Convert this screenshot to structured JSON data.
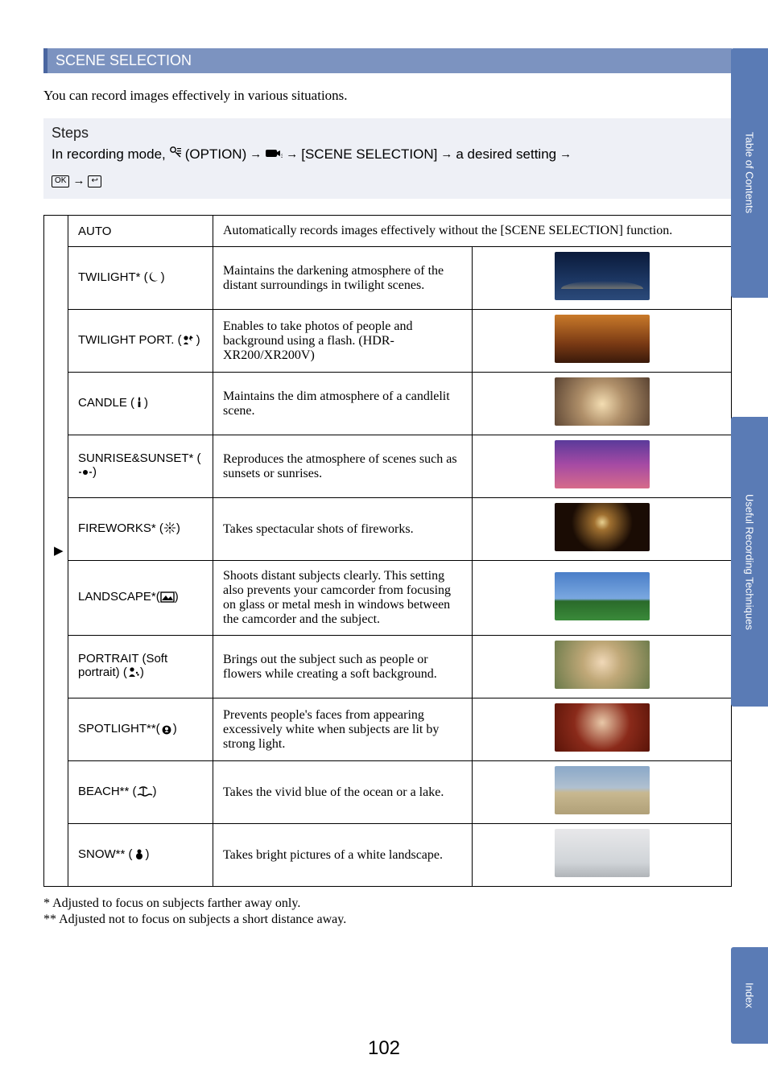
{
  "sidebar": {
    "tabs": [
      {
        "label": "Table of Contents"
      },
      {
        "label": "Useful Recording Techniques"
      },
      {
        "label": "Index"
      }
    ]
  },
  "section_heading": "SCENE SELECTION",
  "intro": "You can record images effectively in various situations.",
  "steps": {
    "title": "Steps",
    "prefix": "In recording mode, ",
    "option_label": " (OPTION) ",
    "bracket": "[SCENE SELECTION]",
    "suffix": " a desired setting ",
    "ok": "OK",
    "ret": "↩"
  },
  "scenes": [
    {
      "mark": "▶",
      "name": "AUTO",
      "desc": "Automatically records images effectively without the [SCENE SELECTION] function.",
      "thumb": null,
      "icon": null
    },
    {
      "mark": "",
      "name": "TWILIGHT* (",
      "desc": "Maintains the darkening atmosphere of the distant surroundings in twilight scenes.",
      "thumb": "th-twilight",
      "icon": "twilight",
      "name_close": ")"
    },
    {
      "mark": "",
      "name": "TWILIGHT PORT. (",
      "desc": "Enables to take photos of people and background using a flash. (HDR-XR200/XR200V)",
      "thumb": "th-twiport",
      "icon": "twiport",
      "name_close": ")"
    },
    {
      "mark": "",
      "name": "CANDLE (",
      "desc": "Maintains the dim atmosphere of a candlelit scene.",
      "thumb": "th-candle",
      "icon": "candle",
      "name_close": ")"
    },
    {
      "mark": "",
      "name": "SUNRISE&SUNSET* (",
      "desc": "Reproduces the atmosphere of scenes such as sunsets or sunrises.",
      "thumb": "th-sunset",
      "icon": "sunset",
      "name_close": ")"
    },
    {
      "mark": "",
      "name": "FIREWORKS* (",
      "desc": "Takes spectacular shots of fireworks.",
      "thumb": "th-firework",
      "icon": "firework",
      "name_close": ")"
    },
    {
      "mark": "",
      "name": "LANDSCAPE*(",
      "desc": "Shoots distant subjects clearly. This setting also prevents your camcorder from focusing on glass or metal mesh in windows between the camcorder and the subject.",
      "thumb": "th-landscape",
      "icon": "landscape",
      "name_close": ")"
    },
    {
      "mark": "",
      "name": "PORTRAIT (Soft portrait) (",
      "desc": "Brings out the subject such as people or flowers while creating a soft background.",
      "thumb": "th-portrait",
      "icon": "portrait",
      "name_close": ")"
    },
    {
      "mark": "",
      "name": "SPOTLIGHT**(",
      "desc": "Prevents people's faces from appearing excessively white when subjects are lit by strong light.",
      "thumb": "th-spotlight",
      "icon": "spotlight",
      "name_close": ")"
    },
    {
      "mark": "",
      "name": "BEACH** (",
      "desc": "Takes the vivid blue of the ocean or a lake.",
      "thumb": "th-beach",
      "icon": "beach",
      "name_close": ")"
    },
    {
      "mark": "",
      "name": "SNOW** (",
      "desc": "Takes bright pictures of a white landscape.",
      "thumb": "th-snow",
      "icon": "snow",
      "name_close": ")"
    }
  ],
  "footnotes": [
    "*   Adjusted to focus on subjects farther away only.",
    "** Adjusted not to focus on subjects a short distance away."
  ],
  "page_number": "102"
}
